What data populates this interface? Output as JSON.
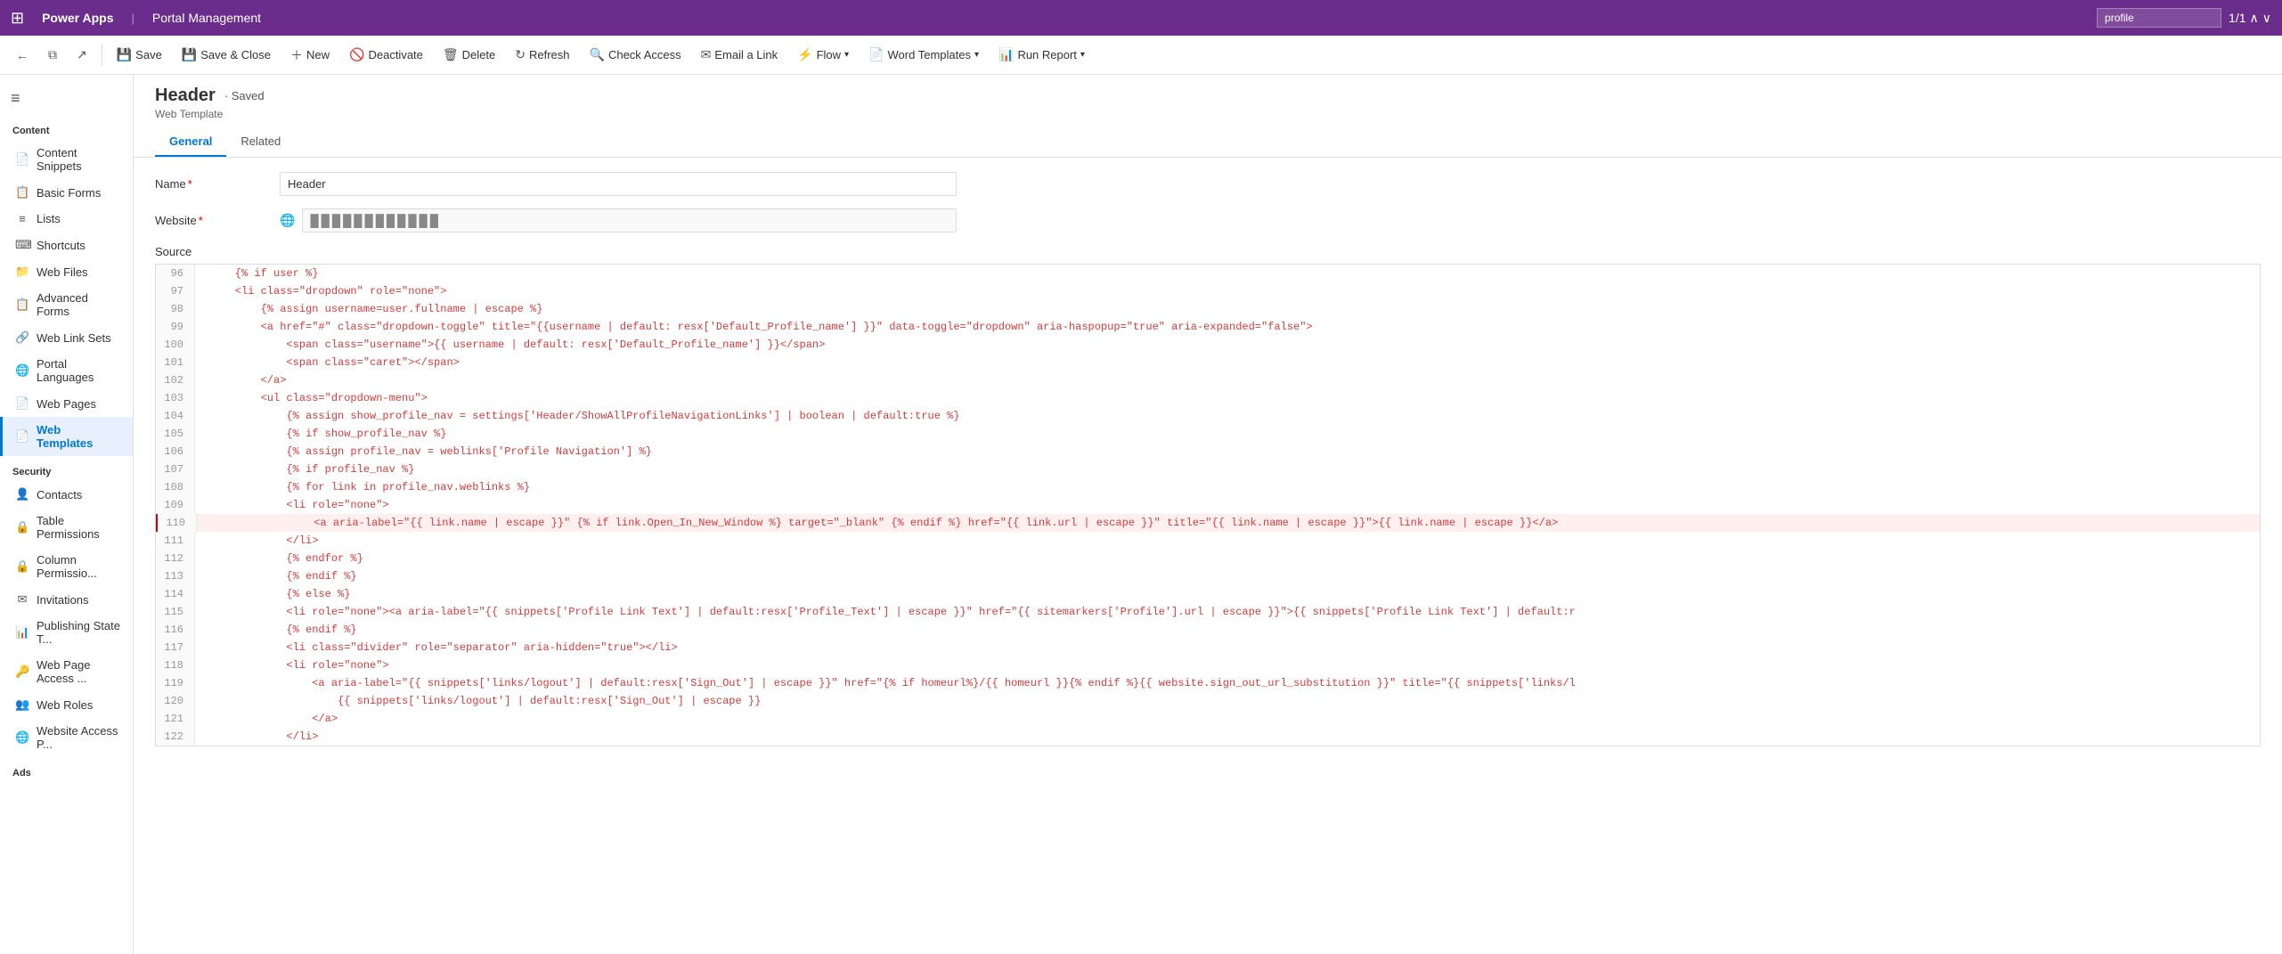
{
  "topbar": {
    "app_name": "Power Apps",
    "divider": "|",
    "portal_name": "Portal Management",
    "search_placeholder": "profile",
    "search_value": "profile",
    "page_count": "1/1"
  },
  "commandbar": {
    "back_label": "←",
    "copy_label": "⧉",
    "share_label": "↗",
    "save_label": "Save",
    "save_close_label": "Save & Close",
    "new_label": "New",
    "deactivate_label": "Deactivate",
    "delete_label": "Delete",
    "refresh_label": "Refresh",
    "check_access_label": "Check Access",
    "email_link_label": "Email a Link",
    "flow_label": "Flow",
    "word_templates_label": "Word Templates",
    "run_report_label": "Run Report"
  },
  "record": {
    "title": "Header",
    "saved_status": "Saved",
    "subtitle": "Web Template",
    "tabs": [
      "General",
      "Related"
    ],
    "active_tab": "General"
  },
  "form": {
    "name_label": "Name",
    "name_required": true,
    "name_value": "Header",
    "website_label": "Website",
    "website_required": true,
    "website_value": "                    "
  },
  "sidebar": {
    "toggle_icon": "≡",
    "sections": [
      {
        "title": "Content",
        "items": [
          {
            "id": "content-snippets",
            "label": "Content Snippets",
            "icon": "📄"
          },
          {
            "id": "basic-forms",
            "label": "Basic Forms",
            "icon": "📋"
          },
          {
            "id": "lists",
            "label": "Lists",
            "icon": "≡"
          },
          {
            "id": "shortcuts",
            "label": "Shortcuts",
            "icon": "⌨"
          },
          {
            "id": "web-files",
            "label": "Web Files",
            "icon": "📁"
          },
          {
            "id": "advanced-forms",
            "label": "Advanced Forms",
            "icon": "📋"
          },
          {
            "id": "web-link-sets",
            "label": "Web Link Sets",
            "icon": "🔗"
          },
          {
            "id": "portal-languages",
            "label": "Portal Languages",
            "icon": "🌐"
          },
          {
            "id": "web-pages",
            "label": "Web Pages",
            "icon": "📄"
          },
          {
            "id": "web-templates",
            "label": "Web Templates",
            "icon": "📄",
            "active": true
          }
        ]
      },
      {
        "title": "Security",
        "items": [
          {
            "id": "contacts",
            "label": "Contacts",
            "icon": "👤"
          },
          {
            "id": "table-permissions",
            "label": "Table Permissions",
            "icon": "🔒"
          },
          {
            "id": "column-permissions",
            "label": "Column Permissio...",
            "icon": "🔒"
          },
          {
            "id": "invitations",
            "label": "Invitations",
            "icon": "✉"
          },
          {
            "id": "publishing-state",
            "label": "Publishing State T...",
            "icon": "📊"
          },
          {
            "id": "web-page-access",
            "label": "Web Page Access ...",
            "icon": "🔑"
          },
          {
            "id": "web-roles",
            "label": "Web Roles",
            "icon": "👥"
          },
          {
            "id": "website-access",
            "label": "Website Access P...",
            "icon": "🌐"
          }
        ]
      },
      {
        "title": "Ads",
        "items": []
      }
    ]
  },
  "source": {
    "label": "Source",
    "lines": [
      {
        "num": 96,
        "content": "    {% if user %}",
        "highlight": false
      },
      {
        "num": 97,
        "content": "    <li class=\"dropdown\" role=\"none\">",
        "highlight": false
      },
      {
        "num": 98,
        "content": "        {% assign username=user.fullname | escape %}",
        "highlight": false
      },
      {
        "num": 99,
        "content": "        <a href=\"#\" class=\"dropdown-toggle\" title=\"{{username | default: resx['Default_Profile_name'] }}\" data-toggle=\"dropdown\" aria-haspopup=\"true\" aria-expanded=\"false\">",
        "highlight": false
      },
      {
        "num": 100,
        "content": "            <span class=\"username\">{{ username | default: resx['Default_Profile_name'] }}</span>",
        "highlight": false
      },
      {
        "num": 101,
        "content": "            <span class=\"caret\"></span>",
        "highlight": false
      },
      {
        "num": 102,
        "content": "        </a>",
        "highlight": false
      },
      {
        "num": 103,
        "content": "        <ul class=\"dropdown-menu\">",
        "highlight": false
      },
      {
        "num": 104,
        "content": "            {% assign show_profile_nav = settings['Header/ShowAllProfileNavigationLinks'] | boolean | default:true %}",
        "highlight": false
      },
      {
        "num": 105,
        "content": "            {% if show_profile_nav %}",
        "highlight": false
      },
      {
        "num": 106,
        "content": "            {% assign profile_nav = weblinks['Profile Navigation'] %}",
        "highlight": false
      },
      {
        "num": 107,
        "content": "            {% if profile_nav %}",
        "highlight": false
      },
      {
        "num": 108,
        "content": "            {% for link in profile_nav.weblinks %}",
        "highlight": false
      },
      {
        "num": 109,
        "content": "            <li role=\"none\">",
        "highlight": false
      },
      {
        "num": 110,
        "content": "                <a aria-label=\"{{ link.name | escape }}\" {% if link.Open_In_New_Window %} target=\"_blank\" {% endif %} href=\"{{ link.url | escape }}\" title=\"{{ link.name | escape }}\">{{ link.name | escape }}</a>",
        "highlight": true
      },
      {
        "num": 111,
        "content": "            </li>",
        "highlight": false
      },
      {
        "num": 112,
        "content": "            {% endfor %}",
        "highlight": false
      },
      {
        "num": 113,
        "content": "            {% endif %}",
        "highlight": false
      },
      {
        "num": 114,
        "content": "            {% else %}",
        "highlight": false
      },
      {
        "num": 115,
        "content": "            <li role=\"none\"><a aria-label=\"{{ snippets['Profile Link Text'] | default:resx['Profile_Text'] | escape }}\" href=\"{{ sitemarkers['Profile'].url | escape }}\">{{ snippets['Profile Link Text'] | default:r",
        "highlight": false
      },
      {
        "num": 116,
        "content": "            {% endif %}",
        "highlight": false
      },
      {
        "num": 117,
        "content": "            <li class=\"divider\" role=\"separator\" aria-hidden=\"true\"></li>",
        "highlight": false
      },
      {
        "num": 118,
        "content": "            <li role=\"none\">",
        "highlight": false
      },
      {
        "num": 119,
        "content": "                <a aria-label=\"{{ snippets['links/logout'] | default:resx['Sign_Out'] | escape }}\" href=\"{% if homeurl%}/{{ homeurl }}{% endif %}{{ website.sign_out_url_substitution }}\" title=\"{{ snippets['links/l",
        "highlight": false
      },
      {
        "num": 120,
        "content": "                    {{ snippets['links/logout'] | default:resx['Sign_Out'] | escape }}",
        "highlight": false
      },
      {
        "num": 121,
        "content": "                </a>",
        "highlight": false
      },
      {
        "num": 122,
        "content": "            </li>",
        "highlight": false
      }
    ]
  }
}
